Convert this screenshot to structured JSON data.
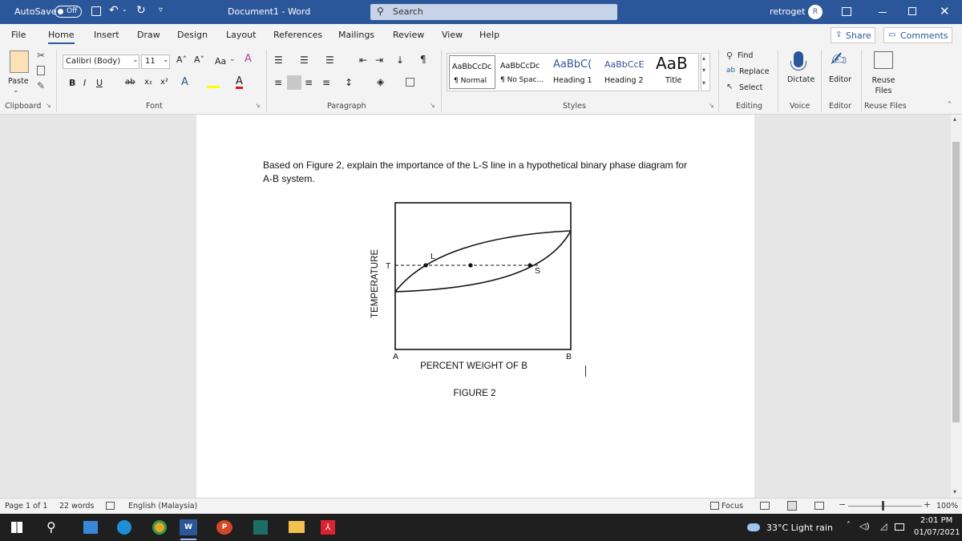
{
  "titlebar": {
    "autosave_label": "AutoSave",
    "autosave_state": "Off",
    "doc_title": "Document1 - Word",
    "search_placeholder": "Search",
    "user_name": "retroget",
    "user_initial": "R"
  },
  "tabs": [
    "File",
    "Home",
    "Insert",
    "Draw",
    "Design",
    "Layout",
    "References",
    "Mailings",
    "Review",
    "View",
    "Help"
  ],
  "active_tab": "Home",
  "share_label": "Share",
  "comments_label": "Comments",
  "ribbon": {
    "paste_label": "Paste",
    "font_name": "Calibri (Body)",
    "font_size": "11",
    "case_label": "Aa",
    "groups": [
      "Clipboard",
      "Font",
      "Paragraph",
      "Styles",
      "Editing",
      "Voice",
      "Editor",
      "Reuse Files"
    ],
    "styles": [
      {
        "sample": "AaBbCcDc",
        "name": "¶ Normal"
      },
      {
        "sample": "AaBbCcDc",
        "name": "¶ No Spac..."
      },
      {
        "sample": "AaBbC(",
        "name": "Heading 1"
      },
      {
        "sample": "AaBbCcE",
        "name": "Heading 2"
      },
      {
        "sample": "AaB",
        "name": "Title"
      }
    ],
    "find_label": "Find",
    "replace_label": "Replace",
    "select_label": "Select",
    "dictate_label": "Dictate",
    "editor_label": "Editor",
    "reuse_label": "Reuse Files"
  },
  "document": {
    "question_text": "Based on Figure 2, explain the importance of the L-S line in a hypothetical binary phase diagram for A-B system.",
    "figure": {
      "ylabel": "TEMPERATURE",
      "xlabel": "PERCENT WEIGHT OF B",
      "left_label": "A",
      "right_label": "B",
      "t_label": "T",
      "l_label": "L",
      "s_label": "S",
      "caption": "FIGURE 2"
    }
  },
  "statusbar": {
    "page": "Page 1 of 1",
    "words": "22 words",
    "language": "English (Malaysia)",
    "focus": "Focus",
    "zoom": "100%"
  },
  "taskbar": {
    "weather": "33°C  Light rain",
    "time": "2:01 PM",
    "date": "01/07/2021"
  }
}
